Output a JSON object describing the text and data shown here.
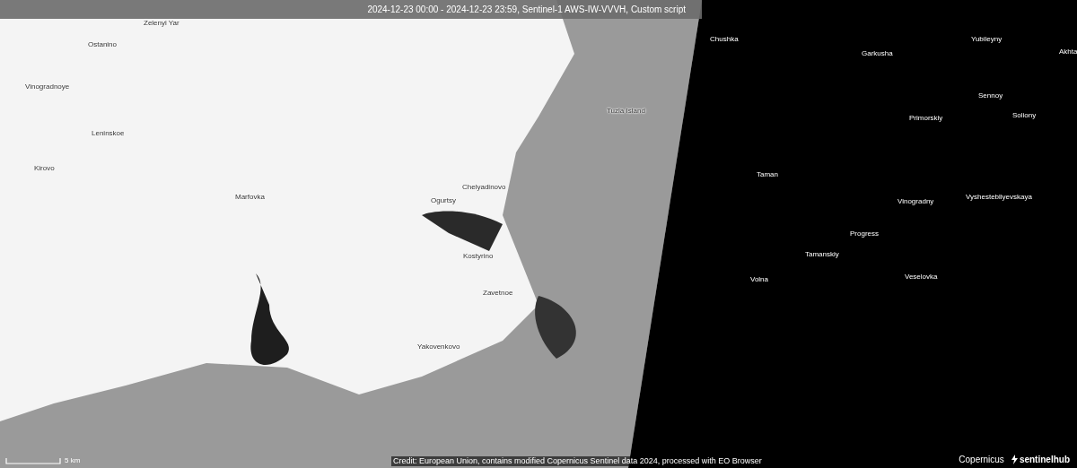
{
  "title_bar": {
    "text": "2024-12-23 00:00 - 2024-12-23 23:59, Sentinel-1 AWS-IW-VVVH, Custom script"
  },
  "land_labels": [
    "Zelenyi Yar",
    "Ostanino",
    "Vinogradnoye",
    "Leninskoe",
    "Kirovo",
    "Marfovka",
    "Chelyadinovo",
    "Ogurtsy",
    "Kostyrino",
    "Zavetnoe",
    "Yakovenkovo",
    "Tuzla Island"
  ],
  "sea_labels": [
    "Chushka",
    "Garkusha",
    "Yubileyny",
    "Akhta",
    "Sennoy",
    "Primorskiy",
    "Soliony",
    "Taman",
    "Vinogradny",
    "Vyshestebliyevskaya",
    "Progress",
    "Tamanskiy",
    "Volna",
    "Veselovka"
  ],
  "scale_bar": {
    "label": "5 km"
  },
  "attribution": "Credit: European Union, contains modified Copernicus Sentinel data 2024, processed with EO Browser",
  "logos": [
    "Copernicus",
    "sentinelhub"
  ]
}
